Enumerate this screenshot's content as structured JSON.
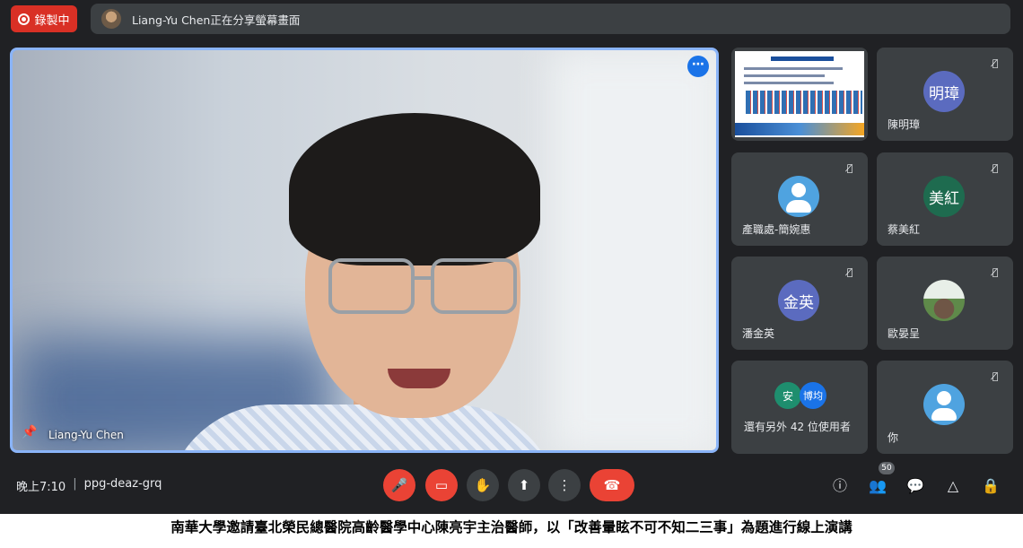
{
  "recording": {
    "label": "錄製中"
  },
  "banner": {
    "text": "Liang-Yu Chen正在分享螢幕畫面"
  },
  "main_speaker": {
    "name": "Liang-Yu Chen"
  },
  "participants": [
    {
      "name": "陳明璋",
      "initials": "明璋",
      "color": "#5b6bbf"
    },
    {
      "name": "產職處-簡婉惠",
      "avatar": "default-person",
      "color": "#4fa3e0"
    },
    {
      "name": "蔡美紅",
      "initials": "美紅",
      "color": "#1e6b4f"
    },
    {
      "name": "潘金英",
      "initials": "金英",
      "color": "#5b6bbf"
    },
    {
      "name": "歐晏呈",
      "avatar": "photo"
    },
    {
      "name": "你",
      "avatar": "default-person",
      "color": "#4fa3e0"
    }
  ],
  "others": {
    "label": "還有另外 42 位使用者",
    "initials": [
      "安",
      "博均"
    ],
    "colors": [
      "#1e8e6e",
      "#1a73e8"
    ]
  },
  "meeting": {
    "time": "晚上7:10",
    "code": "ppg-deaz-grq"
  },
  "people_count": "50",
  "colors": {
    "bg": "#202124",
    "tile": "#3c4043",
    "accent_blue": "#8ab4f8",
    "red": "#ea4335"
  },
  "caption": "南華大學邀請臺北榮民總醫院高齡醫學中心陳亮宇主治醫師，以「改善暈眩不可不知二三事」為題進行線上演講"
}
